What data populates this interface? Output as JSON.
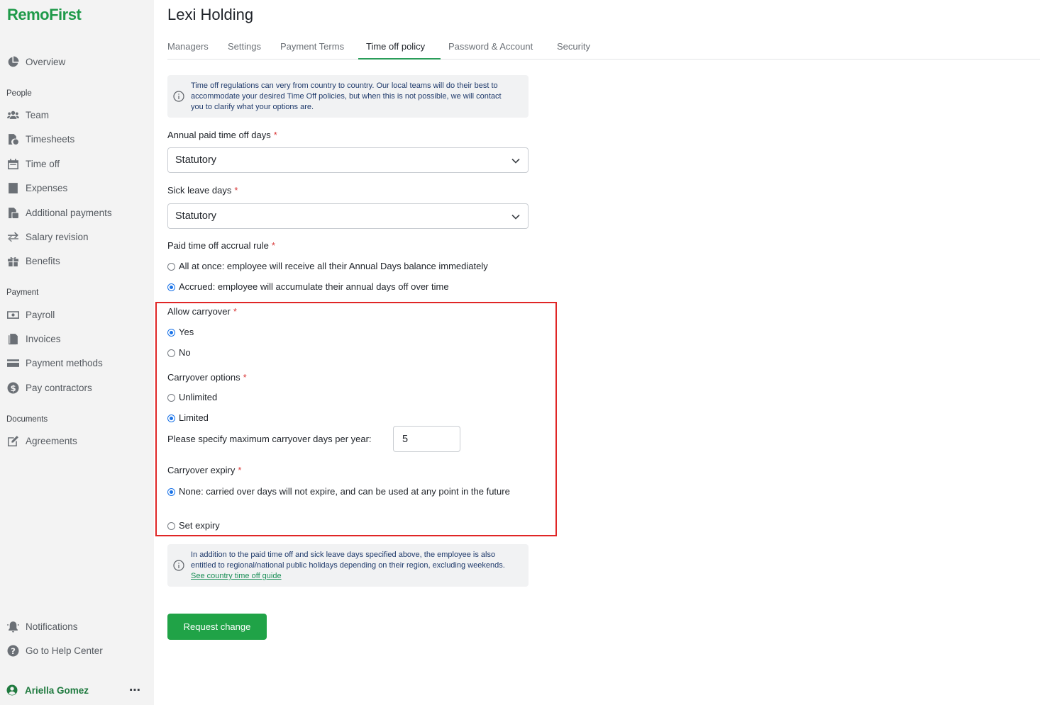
{
  "app": {
    "logo": "RemoFirst"
  },
  "sidebar": {
    "overview": "Overview",
    "sections": {
      "people": "People",
      "payment": "Payment",
      "documents": "Documents"
    },
    "people_items": [
      "Team",
      "Timesheets",
      "Time off",
      "Expenses",
      "Additional payments",
      "Salary revision",
      "Benefits"
    ],
    "payment_items": [
      "Payroll",
      "Invoices",
      "Payment methods",
      "Pay contractors"
    ],
    "documents_items": [
      "Agreements"
    ],
    "bottom_items": [
      "Notifications",
      "Go to Help Center"
    ],
    "user": {
      "name": "Ariella Gomez",
      "more": "⋯"
    }
  },
  "page": {
    "title": "Lexi Holding",
    "tabs": [
      "Managers",
      "Settings",
      "Payment Terms",
      "Time off policy",
      "Password & Account",
      "Security"
    ],
    "active_tab": "Time off policy"
  },
  "info_top": "Time off regulations can very from country to country. Our local teams will do their best to accommodate your desired Time Off policies, but when this is not possible, we will contact you to clarify what your options are.",
  "form": {
    "annual_label": "Annual paid time off days",
    "annual_value": "Statutory",
    "sick_label": "Sick leave days",
    "sick_value": "Statutory",
    "accrual_label": "Paid time off accrual rule",
    "accrual_options": [
      {
        "label": "All at once: employee will receive all their Annual Days balance immediately",
        "selected": false
      },
      {
        "label": "Accrued: employee will accumulate their annual days off over time",
        "selected": true
      }
    ],
    "carryover_label": "Allow carryover",
    "carryover_options": [
      {
        "label": "Yes",
        "selected": true
      },
      {
        "label": "No",
        "selected": false
      }
    ],
    "carryover_opts_label": "Carryover options",
    "carryover_opts": [
      {
        "label": "Unlimited",
        "selected": false
      },
      {
        "label": "Limited",
        "selected": true
      }
    ],
    "max_days_label": "Please specify maximum carryover days per year:",
    "max_days_value": "5",
    "expiry_label": "Carryover expiry",
    "expiry_options": [
      {
        "label": "None: carried over days will not expire, and can be used at any point in the future",
        "selected": true
      },
      {
        "label": "Set expiry",
        "selected": false
      }
    ],
    "required_mark": "*"
  },
  "info_bottom": {
    "text": "In addition to the paid time off and sick leave days specified above, the employee is also entitled to regional/national public holidays depending on their region, excluding weekends. ",
    "link": "See country time off guide"
  },
  "actions": {
    "request_change": "Request change"
  },
  "colors": {
    "brand_green": "#1f9a4a",
    "button_green": "#20a347",
    "radio_blue": "#1a73e8",
    "highlight_red": "#e02626",
    "required_red": "#d93a3a"
  }
}
